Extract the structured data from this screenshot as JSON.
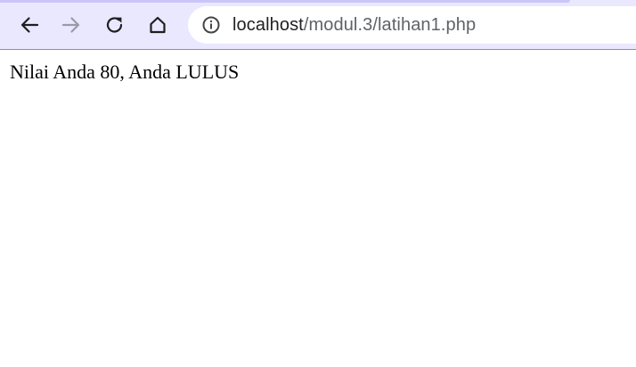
{
  "browser": {
    "address_bar": {
      "host": "localhost",
      "path": "/modul.3/latihan1.php"
    },
    "icons": {
      "back": "back-arrow-icon",
      "forward": "forward-arrow-icon",
      "reload": "reload-icon",
      "home": "home-icon",
      "site_info": "info-icon"
    },
    "colors": {
      "toolbar_background": "#e9e8ff",
      "forward_disabled": "#9a9aa8"
    }
  },
  "page": {
    "text": "Nilai Anda 80, Anda LULUS"
  }
}
